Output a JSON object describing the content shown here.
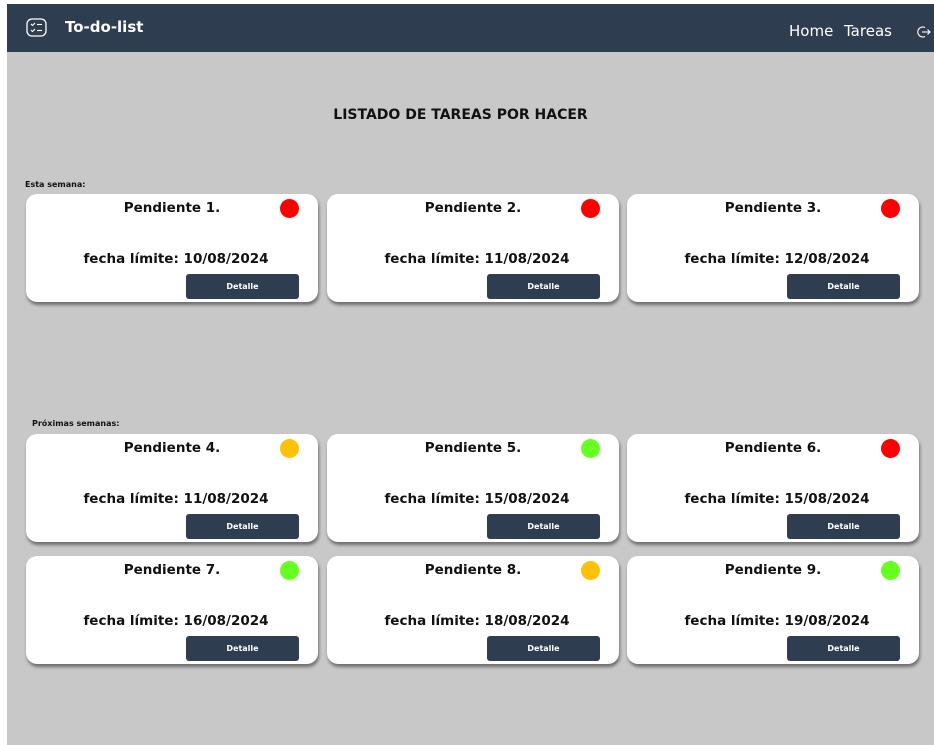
{
  "navbar": {
    "brand": "To-do-list",
    "logo_icon": "checklist-icon",
    "links": [
      {
        "label": "Home"
      },
      {
        "label": "Tareas"
      }
    ],
    "logout_icon": "logout-icon",
    "background": "#2f3d50"
  },
  "page": {
    "title": "LISTADO DE TAREAS POR HACER",
    "background": "#c8c8c8"
  },
  "colors": {
    "red": "#ff0000",
    "yellow": "#ffc107",
    "green": "#66ff22",
    "button": "#2f3d50"
  },
  "sections": [
    {
      "label": "Esta semana:",
      "cards": [
        {
          "title": "Pendiente 1.",
          "date": "fecha límite: 10/08/2024",
          "status": "red",
          "button": "Detalle"
        },
        {
          "title": "Pendiente 2.",
          "date": "fecha límite: 11/08/2024",
          "status": "red",
          "button": "Detalle"
        },
        {
          "title": "Pendiente 3.",
          "date": "fecha límite: 12/08/2024",
          "status": "red",
          "button": "Detalle"
        }
      ]
    },
    {
      "label": "Próximas semanas:",
      "cards": [
        {
          "title": "Pendiente 4.",
          "date": "fecha límite: 11/08/2024",
          "status": "yellow",
          "button": "Detalle"
        },
        {
          "title": "Pendiente 5.",
          "date": "fecha límite: 15/08/2024",
          "status": "green",
          "button": "Detalle"
        },
        {
          "title": "Pendiente 6.",
          "date": "fecha límite: 15/08/2024",
          "status": "red",
          "button": "Detalle"
        },
        {
          "title": "Pendiente 7.",
          "date": "fecha límite: 16/08/2024",
          "status": "green",
          "button": "Detalle"
        },
        {
          "title": "Pendiente 8.",
          "date": "fecha límite: 18/08/2024",
          "status": "yellow",
          "button": "Detalle"
        },
        {
          "title": "Pendiente 9.",
          "date": "fecha límite: 19/08/2024",
          "status": "green",
          "button": "Detalle"
        }
      ]
    }
  ]
}
